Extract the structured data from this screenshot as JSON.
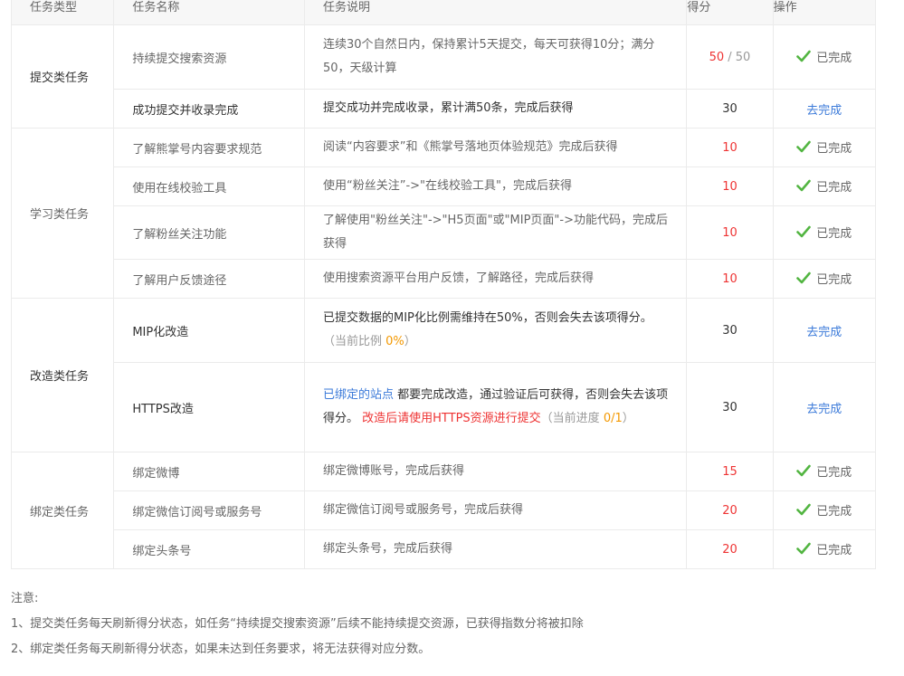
{
  "headers": {
    "type": "任务类型",
    "name": "任务名称",
    "desc": "任务说明",
    "score": "得分",
    "op": "操作"
  },
  "groups": {
    "submit": "提交类任务",
    "learn": "学习类任务",
    "reform": "改造类任务",
    "bind": "绑定类任务"
  },
  "rows": {
    "r1": {
      "name": "持续提交搜索资源",
      "desc": "连续30个自然日内，保持累计5天提交，每天可获得10分；满分50，天级计算",
      "score_have": "50",
      "score_sep": " / ",
      "score_total": "50",
      "op": "已完成"
    },
    "r2": {
      "name": "成功提交并收录完成",
      "desc": "提交成功并完成收录，累计满50条，完成后获得",
      "score": "30",
      "op": "去完成"
    },
    "r3": {
      "name": "了解熊掌号内容要求规范",
      "desc": "阅读“内容要求”和《熊掌号落地页体验规范》完成后获得",
      "score": "10",
      "op": "已完成"
    },
    "r4": {
      "name": "使用在线校验工具",
      "desc": "使用“粉丝关注”->\"在线校验工具\"，完成后获得",
      "score": "10",
      "op": "已完成"
    },
    "r5": {
      "name": "了解粉丝关注功能",
      "desc": "了解使用\"粉丝关注\"->\"H5页面\"或\"MIP页面\"->功能代码，完成后获得",
      "score": "10",
      "op": "已完成"
    },
    "r6": {
      "name": "了解用户反馈途径",
      "desc": "使用搜索资源平台用户反馈，了解路径，完成后获得",
      "score": "10",
      "op": "已完成"
    },
    "r7": {
      "name": "MIP化改造",
      "desc_main": "已提交数据的MIP化比例需维持在50%，否则会失去该项得分。",
      "desc_note_pre": "（当前比例 ",
      "desc_note_val": "0%",
      "desc_note_post": "）",
      "score": "30",
      "op": "去完成"
    },
    "r8": {
      "name": "HTTPS改造",
      "desc_link": "已绑定的站点",
      "desc_mid": " 都要完成改造，通过验证后可获得，否则会失去该项得分。 ",
      "desc_red": "改造后请使用HTTPS资源进行提交",
      "desc_note_pre": "（当前进度 ",
      "desc_note_val": "0/1",
      "desc_note_post": "）",
      "score": "30",
      "op": "去完成"
    },
    "r9": {
      "name": "绑定微博",
      "desc": "绑定微博账号，完成后获得",
      "score": "15",
      "op": "已完成"
    },
    "r10": {
      "name": "绑定微信订阅号或服务号",
      "desc": "绑定微信订阅号或服务号，完成后获得",
      "score": "20",
      "op": "已完成"
    },
    "r11": {
      "name": "绑定头条号",
      "desc": "绑定头条号，完成后获得",
      "score": "20",
      "op": "已完成"
    }
  },
  "notes": {
    "title": "注意:",
    "n1": "1、提交类任务每天刷新得分状态，如任务“持续提交搜索资源”后续不能持续提交资源，已获得指数分将被扣除",
    "n2": "2、绑定类任务每天刷新得分状态，如果未达到任务要求，将无法获得对应分数。"
  },
  "colors": {
    "check": "#52b541",
    "red": "#e33333",
    "orange": "#f39800",
    "blue": "#3b7ad9"
  }
}
